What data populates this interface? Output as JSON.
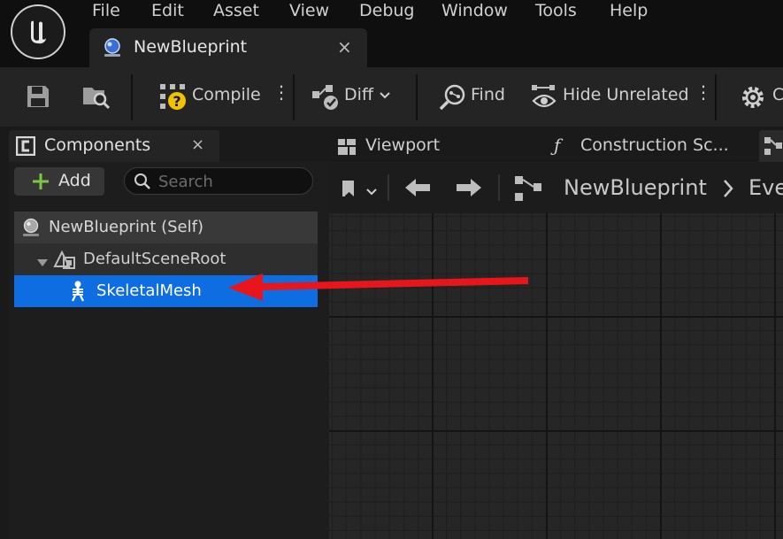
{
  "menu": {
    "items": [
      "File",
      "Edit",
      "Asset",
      "View",
      "Debug",
      "Window",
      "Tools",
      "Help"
    ]
  },
  "document_tab": {
    "title": "NewBlueprint",
    "close": "×"
  },
  "toolbar": {
    "compile_label": "Compile",
    "diff_label": "Diff",
    "find_label": "Find",
    "hide_unrelated_label": "Hide Unrelated",
    "class_settings_label_partial": "C"
  },
  "components_panel": {
    "title": "Components",
    "close": "×",
    "add_label": "Add",
    "search_placeholder": "Search",
    "tree": {
      "self": "NewBlueprint (Self)",
      "root": "DefaultSceneRoot",
      "mesh": "SkeletalMesh"
    }
  },
  "editor_tabs": {
    "viewport": "Viewport",
    "construction": "Construction Sc...",
    "function_glyph": "ƒ"
  },
  "graph": {
    "breadcrumb": "NewBlueprint",
    "breadcrumb_next": "Eve"
  },
  "colors": {
    "selection": "#0e6de0",
    "annotation_arrow": "#e8151b",
    "compile_warning": "#f2c200",
    "add_plus": "#7ac943",
    "tab_blue_icon": "#3a6fd8"
  }
}
